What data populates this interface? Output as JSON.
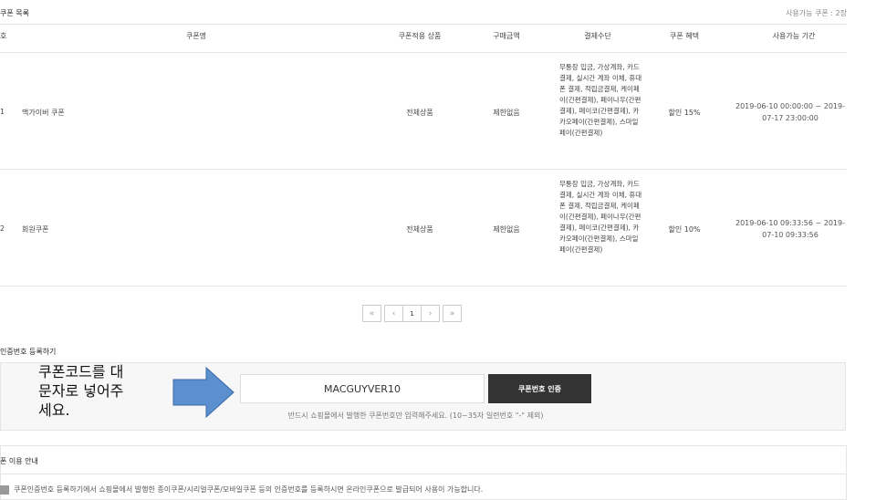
{
  "coupon_list": {
    "title": "쿠폰 목록",
    "available_label": "사용가능 쿠폰 : 2장",
    "headers": {
      "no": "호",
      "name": "쿠폰명",
      "product": "쿠폰적용 상품",
      "amount": "구매금액",
      "payment": "결제수단",
      "benefit": "쿠폰 혜택",
      "period": "사용가능 기간"
    },
    "rows": [
      {
        "no": "1",
        "name": "맥가이버 쿠폰",
        "product": "전체상품",
        "amount": "제한없음",
        "payment": "무통장 입금, 가상계좌, 카드 결제, 실시간 계좌 이체, 휴대폰 결제, 적립금결제, 케이페이(간편결제), 페이나우(간편결제), 페이코(간편결제), 카카오페이(간편결제), 스마일페이(간편결제)",
        "benefit": "할인 15%",
        "period_start": "2019-06-10 00:00:00 ~ 2019-",
        "period_end": "07-17 23:00:00"
      },
      {
        "no": "2",
        "name": "회원쿠폰",
        "product": "전체상품",
        "amount": "제한없음",
        "payment": "무통장 입금, 가상계좌, 카드 결제, 실시간 계좌 이체, 휴대폰 결제, 적립금결제, 케이페이(간편결제), 페이나우(간편결제), 페이코(간편결제), 카카오페이(간편결제), 스마일페이(간편결제)",
        "benefit": "할인 10%",
        "period_start": "2019-06-10 09:33:56 ~ 2019-",
        "period_end": "07-10 09:33:56"
      }
    ]
  },
  "pagination": {
    "first": "«",
    "prev": "‹",
    "current": "1",
    "next": "›",
    "last": "»"
  },
  "register": {
    "title": "인증번호 등록하기",
    "callout_line1": "쿠폰코드를 대",
    "callout_line2": "문자로 넣어주",
    "callout_line3": "세요.",
    "input_value": "MACGUYVER10",
    "button_label": "쿠폰번호 인증",
    "note": "반드시 쇼핑몰에서 발행한 쿠폰번호만 입력해주세요. (10~35자 일련번호 \"-\" 제외)"
  },
  "guide": {
    "title": "폰 이용 안내",
    "text": "쿠폰인증번호 등록하기에서 쇼핑몰에서 발행한 종이쿠폰/시리얼쿠폰/모바일쿠폰 등의 인증번호를 등록하시면 온라인쿠폰으로 발급되어 사용이 가능합니다."
  },
  "colors": {
    "arrow_fill": "#5b8fce",
    "arrow_stroke": "#3b6aa8",
    "button_bg": "#333333",
    "panel_bg": "#f7f7f7"
  }
}
